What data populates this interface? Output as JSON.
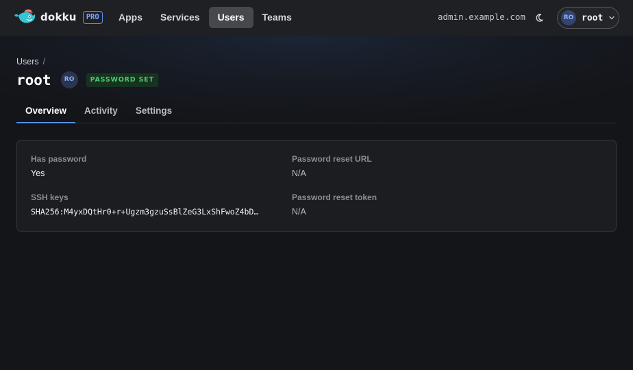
{
  "header": {
    "logo_text": "dokku",
    "pro_badge": "PRO",
    "nav": [
      {
        "label": "Apps"
      },
      {
        "label": "Services"
      },
      {
        "label": "Users"
      },
      {
        "label": "Teams"
      }
    ],
    "active_nav": "Users",
    "host": "admin.example.com",
    "theme_icon": "moon-icon",
    "user_menu": {
      "initials": "RO",
      "name": "root",
      "icon": "chevron-down-icon"
    }
  },
  "page": {
    "breadcrumb": {
      "parent": "Users",
      "separator": "/"
    },
    "title": "root",
    "avatar_initials": "RO",
    "status_badge": "PASSWORD SET",
    "tabs": [
      {
        "label": "Overview"
      },
      {
        "label": "Activity"
      },
      {
        "label": "Settings"
      }
    ],
    "active_tab": "Overview"
  },
  "details": {
    "has_password": {
      "label": "Has password",
      "value": "Yes"
    },
    "password_reset_url": {
      "label": "Password reset URL",
      "value": "N/A"
    },
    "ssh_keys": {
      "label": "SSH keys",
      "value": "SHA256:M4yxDQtHr0+r+Ugzm3gzuSsBlZeG3LxShFwoZ4bD…"
    },
    "password_reset_token": {
      "label": "Password reset token",
      "value": "N/A"
    }
  },
  "colors": {
    "background": "#141519",
    "topbar": "#1f2024",
    "accent": "#5c8ff0",
    "success": "#4cc774"
  }
}
